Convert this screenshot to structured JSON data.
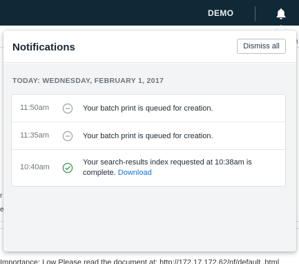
{
  "topbar": {
    "user_label": "DEMO",
    "bell_icon": "bell-icon",
    "background": "#0f2a36"
  },
  "background_page": {
    "right_fragment": "h",
    "left_fragment_1": "r",
    "left_fragment_2": "e",
    "bottom_text": "Importance: Low Please read the document at: http://172.17.172.62/nf/default .html"
  },
  "notifications": {
    "title": "Notifications",
    "dismiss_label": "Dismiss all",
    "section_label": "TODAY: WEDNESDAY, FEBRUARY 1, 2017",
    "items": [
      {
        "time": "11:50am",
        "status": "queued",
        "icon": "minus-circle-icon",
        "message": "Your batch print is queued for creation."
      },
      {
        "time": "11:35am",
        "status": "queued",
        "icon": "minus-circle-icon",
        "message": "Your batch print is queued for creation."
      },
      {
        "time": "10:40am",
        "status": "complete",
        "icon": "check-circle-icon",
        "message": "Your search-results index requested at 10:38am is complete.",
        "link_label": "Download"
      }
    ]
  },
  "colors": {
    "accent_link": "#1f6fc5",
    "success": "#2e9b47",
    "pending": "#9aa1a7"
  }
}
